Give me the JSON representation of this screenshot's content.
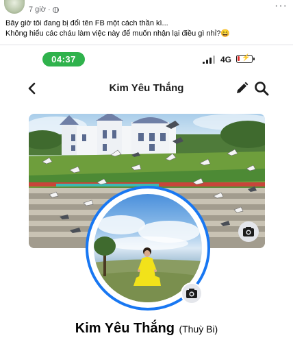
{
  "post": {
    "time": "7 giờ",
    "more_label": "···",
    "lines": [
      "Bây giờ tôi đang bị đổi tên FB một cách thần kì...",
      "Không hiểu các cháu làm việc này để muốn nhận lại điều gì nhỉ?😄"
    ]
  },
  "status_bar": {
    "time": "04:37",
    "network": "4G",
    "battery_level": 0.15,
    "pill_color": "#2fb24c",
    "battery_color": "#e0312f"
  },
  "nav": {
    "title": "Kim Yêu Thắng",
    "icons": [
      "back-arrow",
      "edit-pencil",
      "search"
    ]
  },
  "profile": {
    "name": "Kim Yêu Thắng",
    "alternate_name": "(Thuỳ Bi)",
    "ring_color": "#1877f2",
    "icons": [
      "cover-camera",
      "avatar-camera"
    ]
  }
}
